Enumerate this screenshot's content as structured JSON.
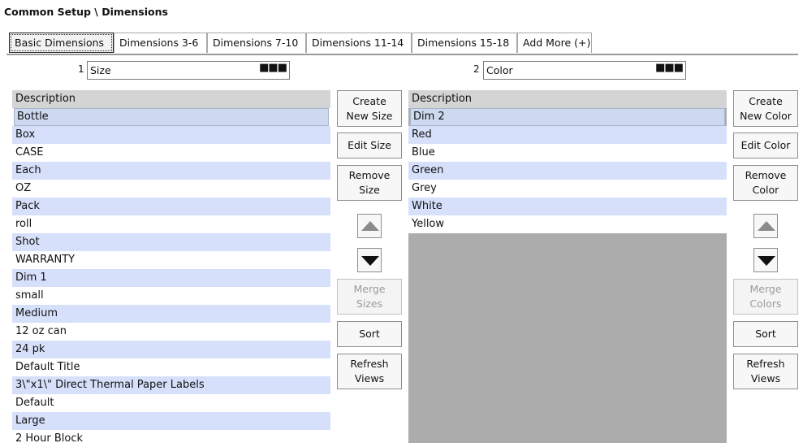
{
  "title": "Common Setup \\ Dimensions",
  "tabs": [
    {
      "label": "Basic Dimensions"
    },
    {
      "label": "Dimensions 3-6"
    },
    {
      "label": "Dimensions 7-10"
    },
    {
      "label": "Dimensions 11-14"
    },
    {
      "label": "Dimensions 15-18"
    },
    {
      "label": "Add More (+)"
    }
  ],
  "dim1": {
    "number": "1",
    "value": "Size",
    "picker_icon": "ellipsis-icon",
    "header": "Description",
    "items": [
      "Bottle",
      "Box",
      "CASE",
      "Each",
      "OZ",
      "Pack",
      "roll",
      "Shot",
      "WARRANTY",
      "Dim 1",
      "small",
      "Medium",
      "12 oz can",
      "24 pk",
      "Default Title",
      "3\\\"x1\\\" Direct Thermal Paper Labels",
      "Default",
      "Large",
      "2 Hour Block"
    ],
    "buttons": {
      "create_line1": "Create",
      "create_line2": "New Size",
      "edit": "Edit Size",
      "remove_line1": "Remove",
      "remove_line2": "Size",
      "merge_line1": "Merge",
      "merge_line2": "Sizes",
      "sort": "Sort",
      "refresh_line1": "Refresh",
      "refresh_line2": "Views"
    }
  },
  "dim2": {
    "number": "2",
    "value": "Color",
    "picker_icon": "ellipsis-icon",
    "header": "Description",
    "items": [
      "Dim 2",
      "Red",
      "Blue",
      "Green",
      "Grey",
      "White",
      "Yellow"
    ],
    "buttons": {
      "create_line1": "Create",
      "create_line2": "New Color",
      "edit": "Edit Color",
      "remove_line1": "Remove",
      "remove_line2": "Color",
      "merge_line1": "Merge",
      "merge_line2": "Colors",
      "sort": "Sort",
      "refresh_line1": "Refresh",
      "refresh_line2": "Views"
    }
  },
  "colors": {
    "row_alt": "#d6e0fb",
    "selected": "#cdd9ee",
    "header": "#d4d4d4",
    "empty_area": "#acacac"
  }
}
